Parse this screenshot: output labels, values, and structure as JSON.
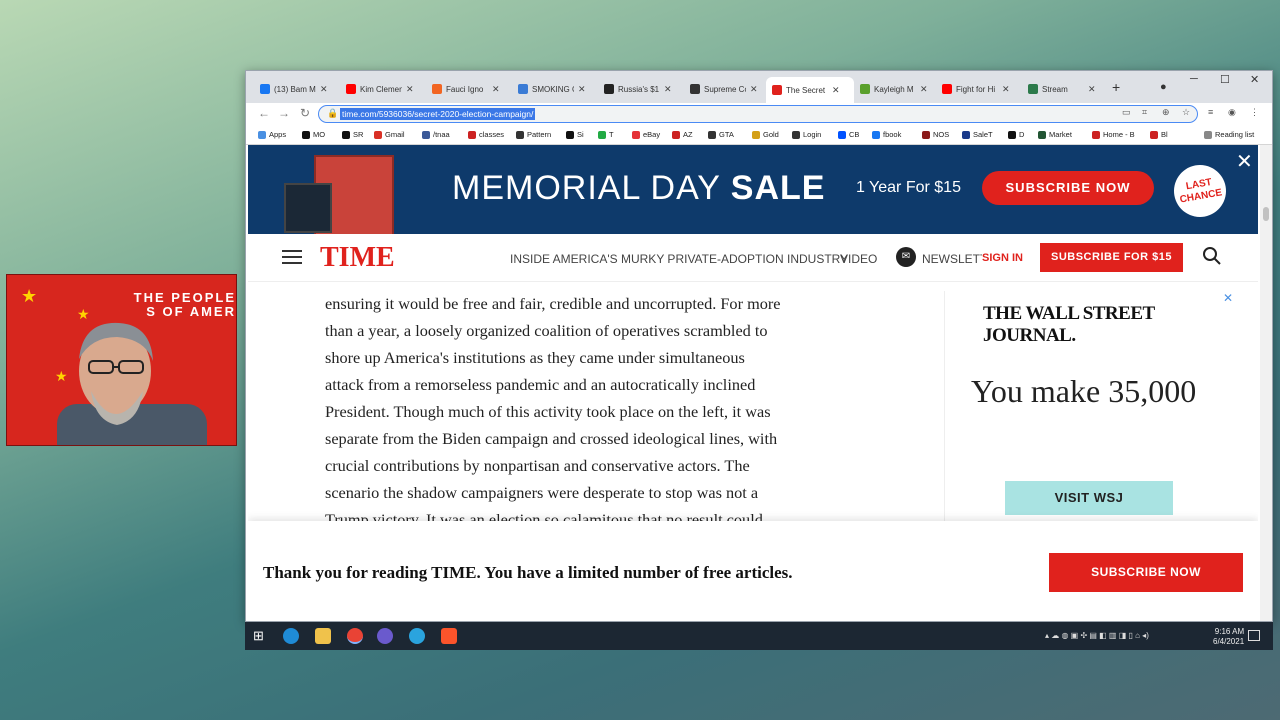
{
  "browser": {
    "tabs": [
      {
        "label": "(13) Bam M",
        "fav_color": "#1877f2"
      },
      {
        "label": "Kim Clemen",
        "fav_color": "#ff0000"
      },
      {
        "label": "Fauci Igno",
        "fav_color": "#f26522"
      },
      {
        "label": "SMOKING G",
        "fav_color": "#3a7bd5"
      },
      {
        "label": "Russia's $1",
        "fav_color": "#222222"
      },
      {
        "label": "Supreme Co",
        "fav_color": "#333333"
      },
      {
        "label": "The Secret",
        "fav_color": "#e0221d"
      },
      {
        "label": "Kayleigh M",
        "fav_color": "#5aa02c"
      },
      {
        "label": "Fight for Hi",
        "fav_color": "#ff0000"
      },
      {
        "label": "Stream",
        "fav_color": "#2c7a4b"
      }
    ],
    "active_tab_index": 6,
    "url": "time.com/5936036/secret-2020-election-campaign/",
    "bookmarks": [
      {
        "label": "Apps",
        "color": "#4a90e2"
      },
      {
        "label": "MO",
        "color": "#111111"
      },
      {
        "label": "SR",
        "color": "#111111"
      },
      {
        "label": "Gmail",
        "color": "#d93025"
      },
      {
        "label": "/tnaa",
        "color": "#3b5998"
      },
      {
        "label": "classes",
        "color": "#cc2222"
      },
      {
        "label": "Pattern",
        "color": "#333333"
      },
      {
        "label": "Si",
        "color": "#111111"
      },
      {
        "label": "T",
        "color": "#22aa44"
      },
      {
        "label": "eBay",
        "color": "#e53238"
      },
      {
        "label": "AZ",
        "color": "#cc2222"
      },
      {
        "label": "GTA",
        "color": "#333333"
      },
      {
        "label": "Gold",
        "color": "#d4a017"
      },
      {
        "label": "Login",
        "color": "#333333"
      },
      {
        "label": "CB",
        "color": "#0052ff"
      },
      {
        "label": "fbook",
        "color": "#1877f2"
      },
      {
        "label": "NOS",
        "color": "#8b1a1a"
      },
      {
        "label": "SaleT",
        "color": "#1a3a8a"
      },
      {
        "label": "D",
        "color": "#111111"
      },
      {
        "label": "Market",
        "color": "#225533"
      },
      {
        "label": "Home - B",
        "color": "#cc2222"
      },
      {
        "label": "Bl",
        "color": "#cc2222"
      }
    ],
    "reading_list": "Reading list"
  },
  "webcam": {
    "banner": "THE PEOPLE\nS OF AMER"
  },
  "promo": {
    "headline_a": "MEMORIAL DAY ",
    "headline_b": "SALE",
    "offer": "1 Year For $15",
    "cta": "SUBSCRIBE NOW",
    "badge": "LAST\nCHANCE",
    "close": "✕"
  },
  "timenav": {
    "logo": "TIME",
    "link_feature": "INSIDE AMERICA'S MURKY PRIVATE-ADOPTION INDUSTRY",
    "link_video": "VIDEO",
    "link_newsletters": "NEWSLETTERS",
    "sign_in": "SIGN IN",
    "subscribe": "SUBSCRIBE FOR $15"
  },
  "article": {
    "lines": [
      "ensuring it would be free and fair, credible and uncorrupted. For more",
      "than a year, a loosely organized coalition of operatives scrambled to",
      "shore up America's institutions as they came under simultaneous",
      "attack from a remorseless pandemic and an autocratically inclined",
      "President. Though much of this activity took place on the left, it was",
      "separate from the Biden campaign and crossed ideological lines, with",
      "crucial contributions by nonpartisan and conservative actors. The",
      "scenario the shadow campaigners were desperate to stop was not a",
      "Trump victory. It was an election so calamitous that no result could"
    ]
  },
  "ad": {
    "brand": "THE WALL STREET JOURNAL.",
    "headline": "You make 35,000",
    "cta": "VISIT WSJ"
  },
  "paywall": {
    "message": "Thank you for reading TIME. You have a limited number of free articles.",
    "cta": "SUBSCRIBE NOW"
  },
  "taskbar": {
    "time": "9:16 AM",
    "date": "6/4/2021"
  }
}
